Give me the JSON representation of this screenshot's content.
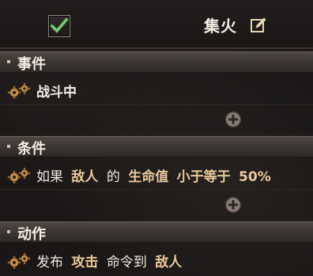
{
  "titlebar": {
    "checked": true,
    "title": "集火",
    "edit_icon": "edit-icon"
  },
  "colors": {
    "accent_text": "#e9c99a",
    "checkmark": "#5fb35a",
    "header_bg": "#3b3532"
  },
  "sections": {
    "event": {
      "header": "事件",
      "row": {
        "text": "战斗中"
      }
    },
    "condition": {
      "header": "条件",
      "row": {
        "w1": "如果",
        "w2": "敌人",
        "w3": "的",
        "w4": "生命值",
        "w5": "小于等于",
        "w6": "50%"
      }
    },
    "action": {
      "header": "动作",
      "row": {
        "w1": "发布",
        "w2": "攻击",
        "w3": "命令到",
        "w4": "敌人"
      }
    }
  },
  "icons": {
    "gears": "gears-icon",
    "add": "plus-circle-icon"
  }
}
